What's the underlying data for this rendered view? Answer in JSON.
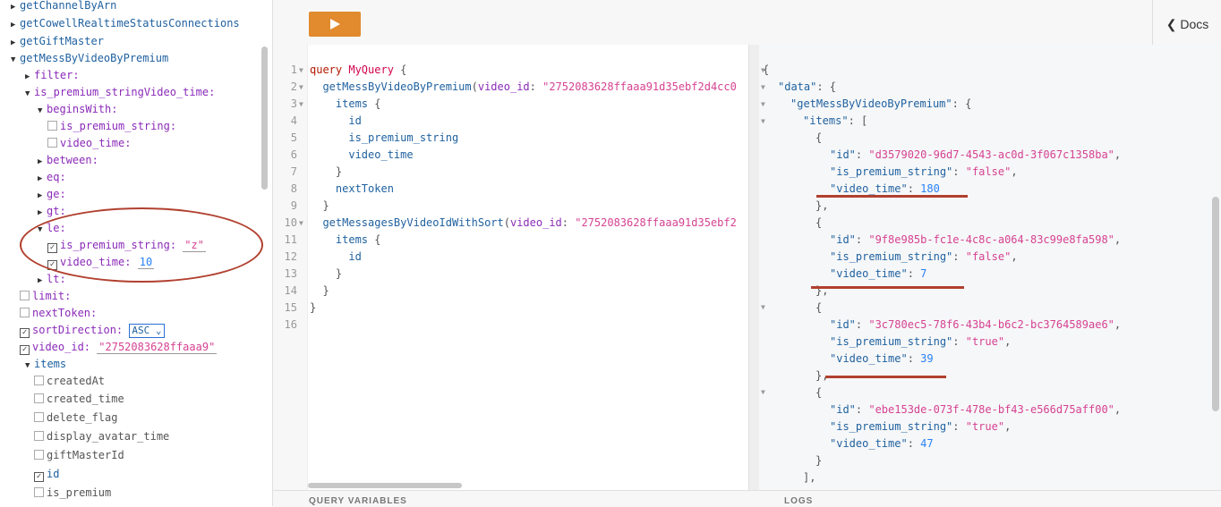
{
  "toolbar": {
    "docs_label": "Docs",
    "docs_chevron": "chevron-left-icon",
    "run_icon": "play-icon"
  },
  "explorer": {
    "items": [
      {
        "t": "getChannelByArn"
      },
      {
        "t": "getCowellRealtimeStatusConnections"
      },
      {
        "t": "getGiftMaster"
      },
      {
        "t": "getMessByVideoByPremium"
      },
      {
        "t": "filter:"
      },
      {
        "t": "is_premium_stringVideo_time:"
      },
      {
        "t": "beginsWith:"
      },
      {
        "t": "is_premium_string:"
      },
      {
        "t": "video_time:"
      },
      {
        "t": "between:"
      },
      {
        "t": "eq:"
      },
      {
        "t": "ge:"
      },
      {
        "t": "gt:"
      },
      {
        "t": "le:"
      },
      {
        "t": "is_premium_string:",
        "v": "\"z\""
      },
      {
        "t": "video_time:",
        "v": "10"
      },
      {
        "t": "lt:"
      },
      {
        "t": "limit:"
      },
      {
        "t": "nextToken:"
      },
      {
        "t": "sortDirection:",
        "v": "ASC"
      },
      {
        "t": "video_id:",
        "v": "\"2752083628ffaaa9\""
      },
      {
        "t": "items"
      },
      {
        "t": "createdAt"
      },
      {
        "t": "created_time"
      },
      {
        "t": "delete_flag"
      },
      {
        "t": "display_avatar_time"
      },
      {
        "t": "giftMasterId"
      },
      {
        "t": "id"
      },
      {
        "t": "is_premium"
      }
    ]
  },
  "query": {
    "line_numbers": [
      "1",
      "2",
      "3",
      "4",
      "5",
      "6",
      "7",
      "8",
      "9",
      "10",
      "11",
      "12",
      "13",
      "14",
      "15",
      "16"
    ],
    "kw_query": "query",
    "op_name": "MyQuery",
    "f1": "getMessByVideoByPremium",
    "f2": "getMessagesByVideoIdWithSort",
    "arg_video_id": "video_id",
    "str1": "\"2752083628ffaaa91d35ebf2d4cc0",
    "str2": "\"2752083628ffaaa91d35ebf2",
    "items": "items",
    "id": "id",
    "is_premium_string": "is_premium_string",
    "video_time": "video_time",
    "nextToken": "nextToken"
  },
  "result": {
    "k_data": "\"data\"",
    "k_fn": "\"getMessByVideoByPremium\"",
    "k_items": "\"items\"",
    "k_id": "\"id\"",
    "k_ips": "\"is_premium_string\"",
    "k_vt": "\"video_time\"",
    "records": [
      {
        "id": "\"d3579020-96d7-4543-ac0d-3f067c1358ba\"",
        "ips": "\"false\"",
        "vt": "180"
      },
      {
        "id": "\"9f8e985b-fc1e-4c8c-a064-83c99e8fa598\"",
        "ips": "\"false\"",
        "vt": "7"
      },
      {
        "id": "\"3c780ec5-78f6-43b4-b6c2-bc3764589ae6\"",
        "ips": "\"true\"",
        "vt": "39"
      },
      {
        "id": "\"ebe153de-073f-478e-bf43-e566d75aff00\"",
        "ips": "\"true\"",
        "vt": "47"
      }
    ]
  },
  "panels": {
    "query_variables": "QUERY VARIABLES",
    "logs": "LOGS"
  }
}
